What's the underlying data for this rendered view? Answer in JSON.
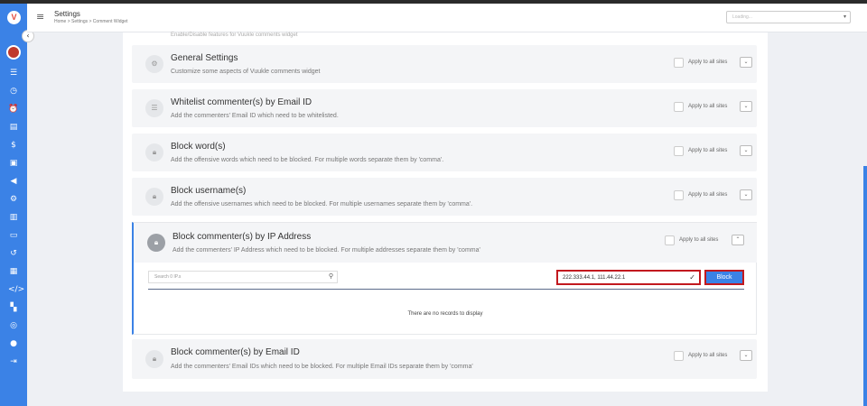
{
  "header": {
    "title": "Settings",
    "breadcrumb": "Home  >  Settings  >  Comment Widget",
    "site_selector": "Loading...",
    "menu_icon": "hamburger-icon"
  },
  "sidebar": {
    "logo": "V",
    "icons": [
      "list-icon",
      "clock-icon",
      "alarm-icon",
      "book-icon",
      "dollar-icon",
      "image-icon",
      "megaphone-icon",
      "gear-icon",
      "chart-icon",
      "card-icon",
      "history-icon",
      "layout-icon",
      "code-icon",
      "building-icon",
      "globe-icon",
      "chat-icon",
      "logout-icon"
    ]
  },
  "partial_card": {
    "desc": "Enable/Disable features for Vuukle comments widget"
  },
  "cards": [
    {
      "title": "General Settings",
      "desc": "Customize some aspects of Vuukle comments widget",
      "icon": "gear-icon"
    },
    {
      "title": "Whitelist commenter(s) by Email ID",
      "desc": "Add the commenters' Email ID which need to be whitelisted.",
      "icon": "list-icon"
    },
    {
      "title": "Block word(s)",
      "desc": "Add the offensive words which need to be blocked. For multiple words separate them by 'comma'.",
      "icon": "lock-icon"
    },
    {
      "title": "Block username(s)",
      "desc": "Add the offensive usernames which need to be blocked. For multiple usernames separate them by 'comma'.",
      "icon": "lock-icon"
    }
  ],
  "apply_label": "Apply to all sites",
  "expanded_card": {
    "title": "Block commenter(s) by IP Address",
    "desc": "Add the commenters' IP Address which need to be blocked. For multiple addresses separate them by 'comma'",
    "search_placeholder": "Search 0 IP.s",
    "ip_value": "222.333.44.1, 111.44.22.1",
    "block_label": "Block",
    "empty_message": "There are no records to display"
  },
  "last_card": {
    "title": "Block commenter(s) by Email ID",
    "desc": "Add the commenters' Email IDs which need to be blocked. For multiple Email IDs separate them by 'comma'"
  }
}
